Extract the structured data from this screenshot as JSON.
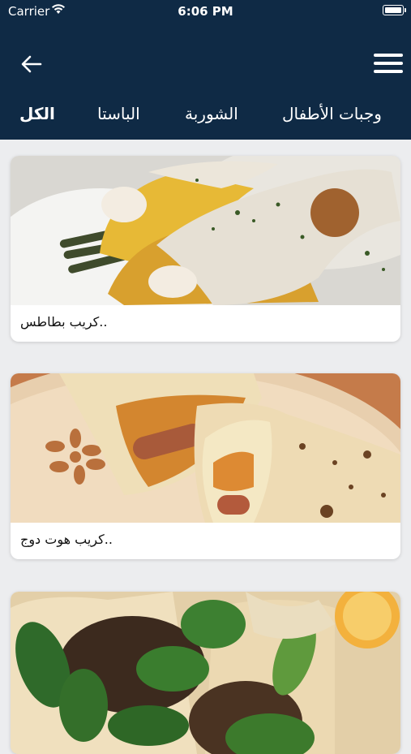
{
  "status_bar": {
    "carrier": "Carrier",
    "time": "6:06 PM"
  },
  "nav": {
    "back_icon": "arrow-left-icon",
    "menu_icon": "hamburger-menu-icon"
  },
  "tabs": [
    {
      "label": "الكل",
      "active": true
    },
    {
      "label": "الباستا",
      "active": false
    },
    {
      "label": "الشوربة",
      "active": false
    },
    {
      "label": "وجبات الأطفال",
      "active": false
    }
  ],
  "recipes": [
    {
      "title": "كريب بطاطس.."
    },
    {
      "title": "كريب هوت دوج.."
    },
    {
      "title": ""
    }
  ],
  "colors": {
    "header": "#0f2a45",
    "background": "#ecedef",
    "card": "#ffffff"
  }
}
